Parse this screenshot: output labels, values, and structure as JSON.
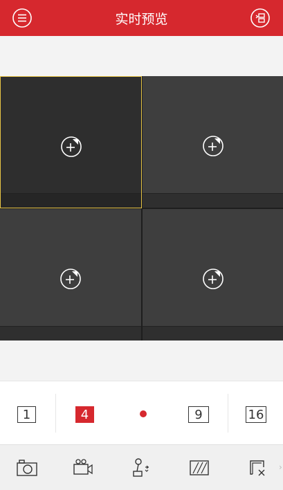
{
  "header": {
    "title": "实时预览",
    "left_icon": "menu-icon",
    "right_icon": "device-list-icon"
  },
  "grid": {
    "panes": [
      {
        "selected": true,
        "icon": "add-camera-icon"
      },
      {
        "selected": false,
        "icon": "add-camera-icon"
      },
      {
        "selected": false,
        "icon": "add-camera-icon"
      },
      {
        "selected": false,
        "icon": "add-camera-icon"
      }
    ]
  },
  "layout_bar": {
    "options": [
      "1",
      "4",
      "9",
      "16"
    ],
    "active": "4"
  },
  "toolbar": {
    "tools": [
      "capture-icon",
      "record-icon",
      "ptz-icon",
      "image-quality-icon",
      "close-all-icon"
    ],
    "more": "›"
  },
  "colors": {
    "brand": "#d6282e",
    "selection": "#e8c545"
  }
}
